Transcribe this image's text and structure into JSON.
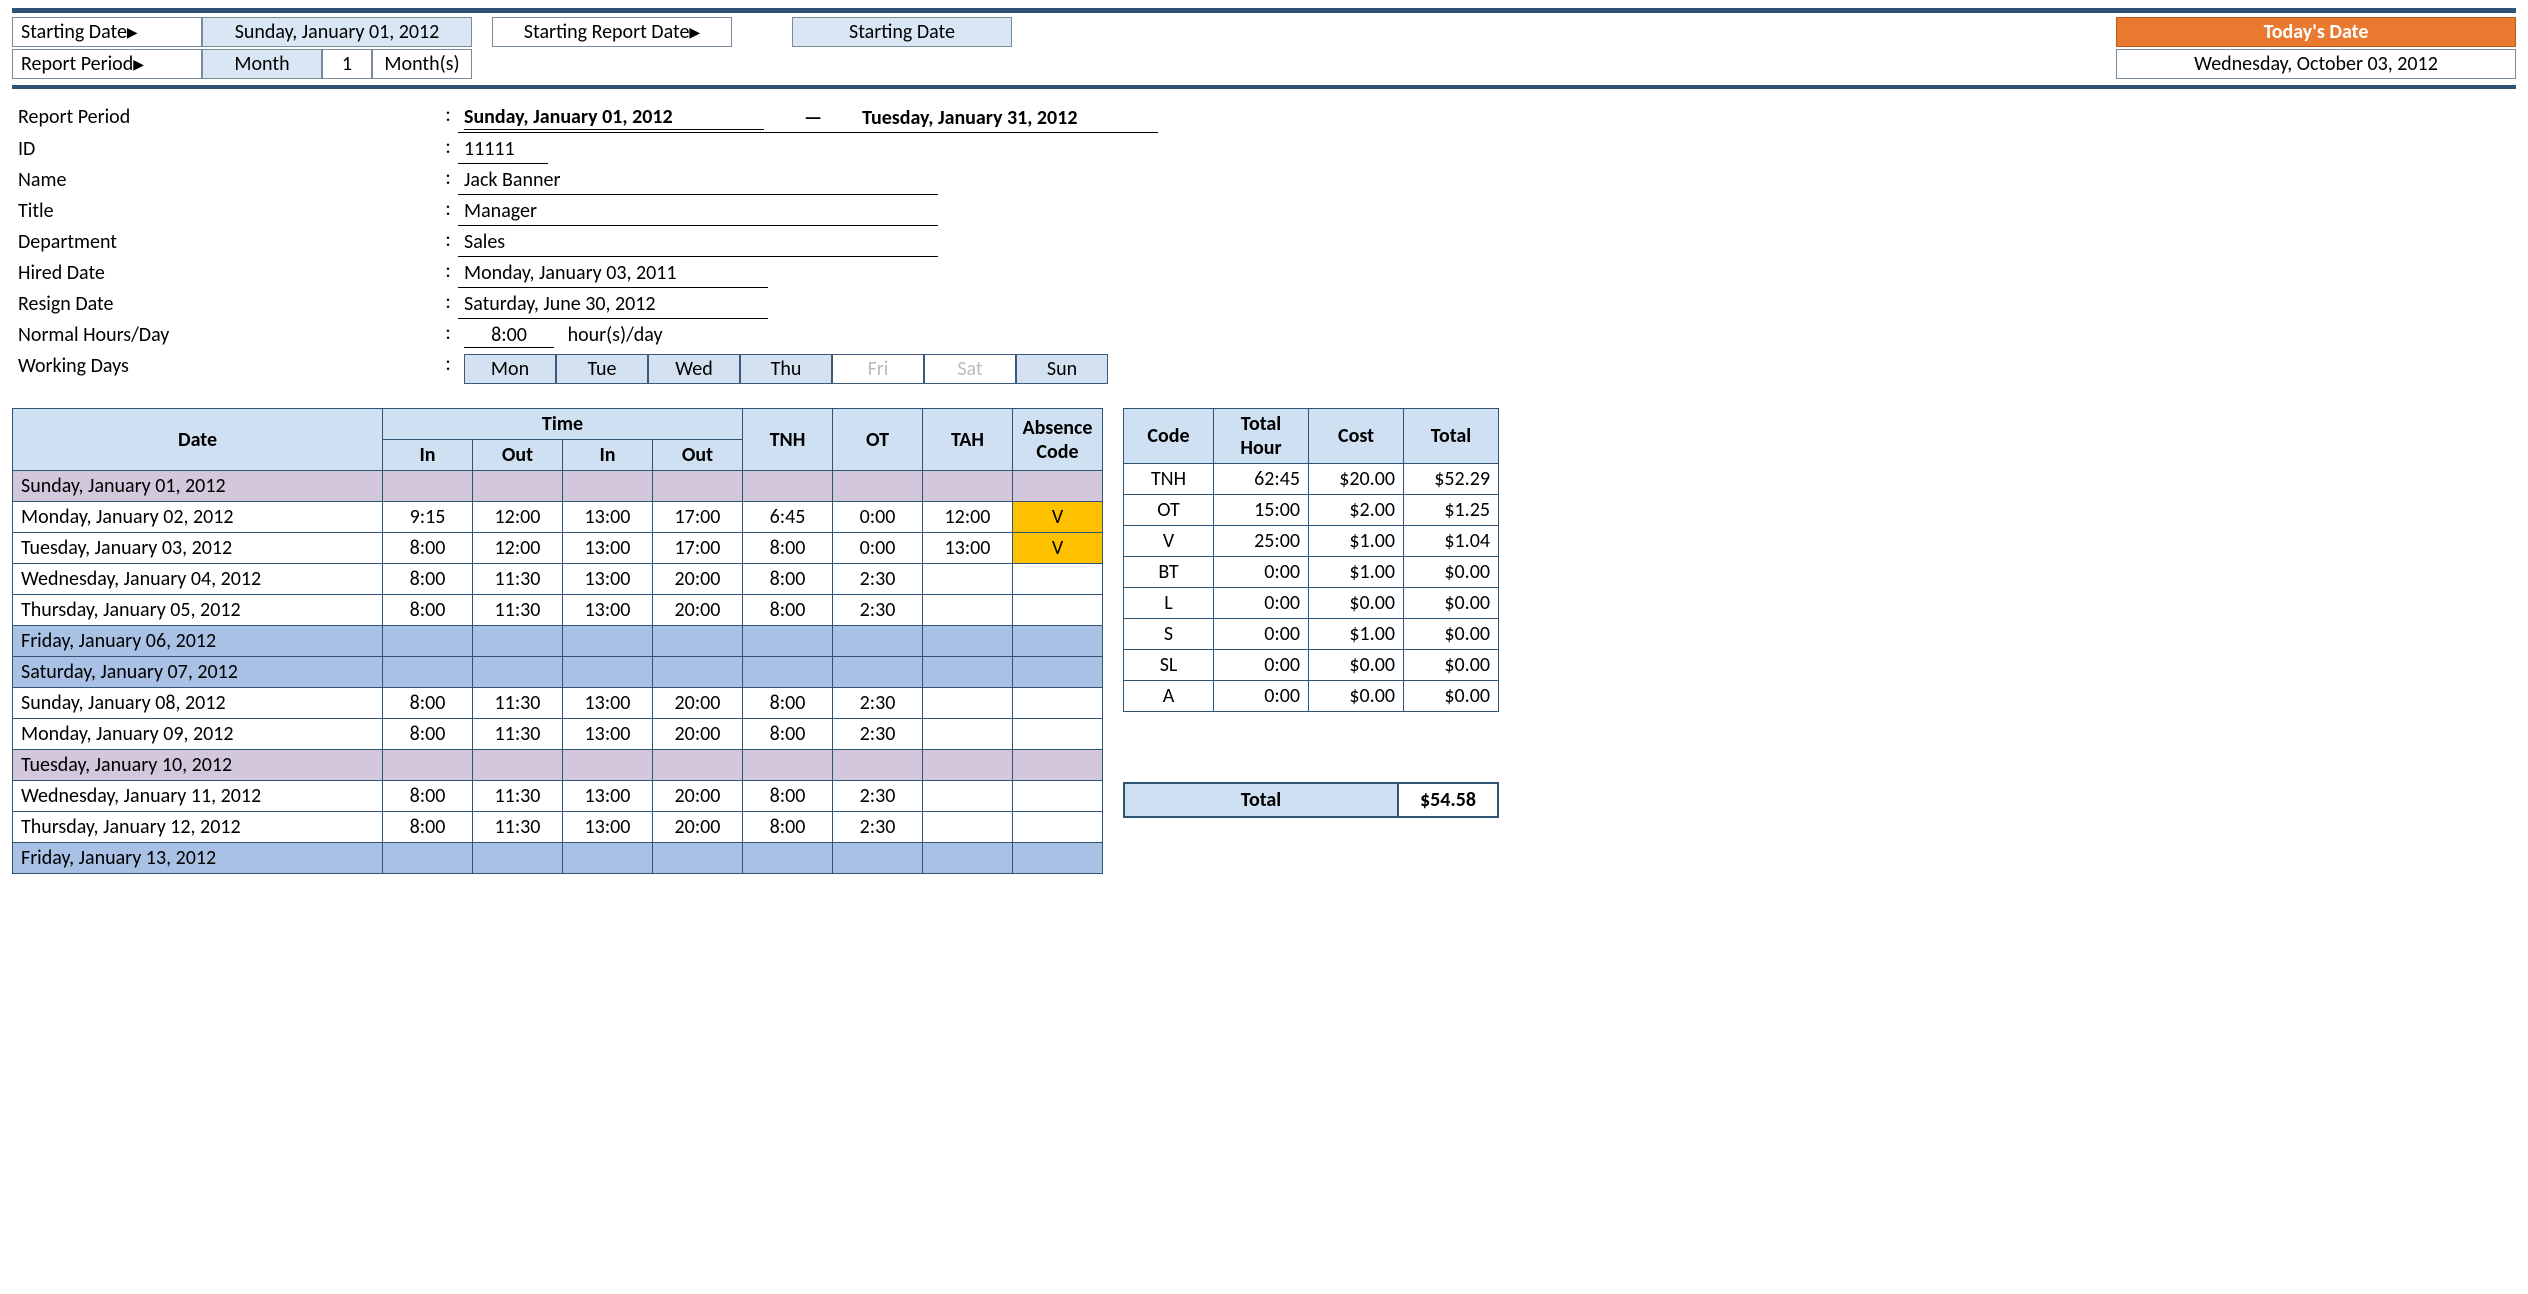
{
  "header": {
    "starting_date_label": "Starting Date",
    "starting_date_value": "Sunday, January 01, 2012",
    "report_period_label": "Report Period",
    "rp_unit": "Month",
    "rp_num": "1",
    "rp_units": "Month(s)",
    "srd_label": "Starting Report Date",
    "srd_value": "Starting Date",
    "today_label": "Today's Date",
    "today_value": "Wednesday, October 03, 2012"
  },
  "info": {
    "labels": {
      "report_period": "Report Period",
      "id": "ID",
      "name": "Name",
      "title": "Title",
      "department": "Department",
      "hired": "Hired Date",
      "resign": "Resign Date",
      "normal": "Normal Hours/Day",
      "working": "Working Days"
    },
    "period_start": "Sunday, January 01, 2012",
    "period_dash": "—",
    "period_end": "Tuesday, January 31, 2012",
    "id": "11111",
    "name": "Jack Banner",
    "title": "Manager",
    "department": "Sales",
    "hired": "Monday, January 03, 2011",
    "resign": "Saturday, June 30, 2012",
    "normal_hours": "8:00",
    "normal_suffix": "hour(s)/day",
    "days": [
      {
        "abbr": "Mon",
        "on": true
      },
      {
        "abbr": "Tue",
        "on": true
      },
      {
        "abbr": "Wed",
        "on": true
      },
      {
        "abbr": "Thu",
        "on": true
      },
      {
        "abbr": "Fri",
        "on": false
      },
      {
        "abbr": "Sat",
        "on": false
      },
      {
        "abbr": "Sun",
        "on": true
      }
    ]
  },
  "ts_headers": {
    "date": "Date",
    "time": "Time",
    "in": "In",
    "out": "Out",
    "tnh": "TNH",
    "ot": "OT",
    "tah": "TAH",
    "abs": "Absence Code"
  },
  "timesheet": [
    {
      "date": "Sunday, January 01, 2012",
      "cls": "purple"
    },
    {
      "date": "Monday, January 02, 2012",
      "in1": "9:15",
      "out1": "12:00",
      "in2": "13:00",
      "out2": "17:00",
      "tnh": "6:45",
      "ot": "0:00",
      "tah": "12:00",
      "abs": "V"
    },
    {
      "date": "Tuesday, January 03, 2012",
      "in1": "8:00",
      "out1": "12:00",
      "in2": "13:00",
      "out2": "17:00",
      "tnh": "8:00",
      "ot": "0:00",
      "tah": "13:00",
      "abs": "V"
    },
    {
      "date": "Wednesday, January 04, 2012",
      "in1": "8:00",
      "out1": "11:30",
      "in2": "13:00",
      "out2": "20:00",
      "tnh": "8:00",
      "ot": "2:30"
    },
    {
      "date": "Thursday, January 05, 2012",
      "in1": "8:00",
      "out1": "11:30",
      "in2": "13:00",
      "out2": "20:00",
      "tnh": "8:00",
      "ot": "2:30"
    },
    {
      "date": "Friday, January 06, 2012",
      "cls": "blue"
    },
    {
      "date": "Saturday, January 07, 2012",
      "cls": "blue"
    },
    {
      "date": "Sunday, January 08, 2012",
      "in1": "8:00",
      "out1": "11:30",
      "in2": "13:00",
      "out2": "20:00",
      "tnh": "8:00",
      "ot": "2:30"
    },
    {
      "date": "Monday, January 09, 2012",
      "in1": "8:00",
      "out1": "11:30",
      "in2": "13:00",
      "out2": "20:00",
      "tnh": "8:00",
      "ot": "2:30"
    },
    {
      "date": "Tuesday, January 10, 2012",
      "cls": "purple"
    },
    {
      "date": "Wednesday, January 11, 2012",
      "in1": "8:00",
      "out1": "11:30",
      "in2": "13:00",
      "out2": "20:00",
      "tnh": "8:00",
      "ot": "2:30"
    },
    {
      "date": "Thursday, January 12, 2012",
      "in1": "8:00",
      "out1": "11:30",
      "in2": "13:00",
      "out2": "20:00",
      "tnh": "8:00",
      "ot": "2:30"
    },
    {
      "date": "Friday, January 13, 2012",
      "cls": "blue"
    }
  ],
  "sum_headers": {
    "code": "Code",
    "hour": "Total Hour",
    "cost": "Cost",
    "total": "Total"
  },
  "summary": [
    {
      "code": "TNH",
      "hour": "62:45",
      "cost": "$20.00",
      "total": "$52.29"
    },
    {
      "code": "OT",
      "hour": "15:00",
      "cost": "$2.00",
      "total": "$1.25"
    },
    {
      "code": "V",
      "hour": "25:00",
      "cost": "$1.00",
      "total": "$1.04"
    },
    {
      "code": "BT",
      "hour": "0:00",
      "cost": "$1.00",
      "total": "$0.00"
    },
    {
      "code": "L",
      "hour": "0:00",
      "cost": "$0.00",
      "total": "$0.00"
    },
    {
      "code": "S",
      "hour": "0:00",
      "cost": "$1.00",
      "total": "$0.00"
    },
    {
      "code": "SL",
      "hour": "0:00",
      "cost": "$0.00",
      "total": "$0.00"
    },
    {
      "code": "A",
      "hour": "0:00",
      "cost": "$0.00",
      "total": "$0.00"
    }
  ],
  "grand": {
    "label": "Total",
    "value": "$54.58"
  }
}
